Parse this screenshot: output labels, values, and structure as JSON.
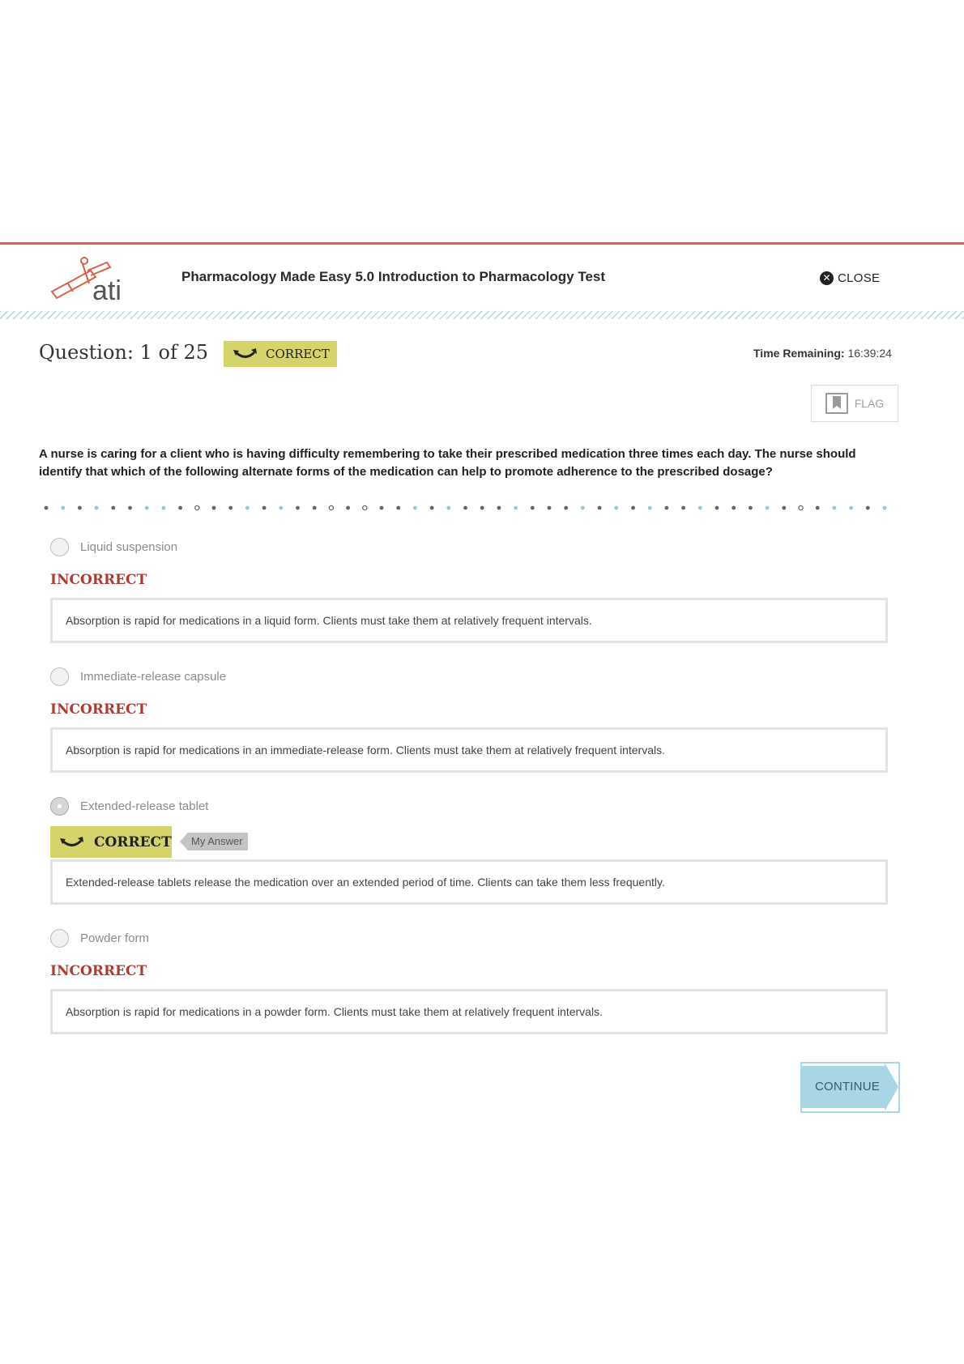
{
  "header": {
    "logo_text": "ati",
    "test_title": "Pharmacology Made Easy 5.0 Introduction to Pharmacology Test",
    "close_label": "CLOSE",
    "close_icon": "close-circle-icon"
  },
  "question": {
    "heading": "Question: 1 of 25",
    "status_badge": "CORRECT",
    "time_label": "Time Remaining:",
    "time_value": "16:39:24",
    "flag_label": "FLAG",
    "text": "A nurse is caring for a client who is having difficulty remembering to take their prescribed medication three times each day. The nurse should identify that which of the following alternate forms of the medication can help to promote adherence to the prescribed dosage?"
  },
  "options": [
    {
      "label": "Liquid suspension",
      "selected": false,
      "status": "INCORRECT",
      "rationale": "Absorption is rapid for medications in a liquid form. Clients must take them at relatively frequent intervals."
    },
    {
      "label": "Immediate-release capsule",
      "selected": false,
      "status": "INCORRECT",
      "rationale": "Absorption is rapid for medications in an immediate-release form. Clients must take them at relatively frequent intervals."
    },
    {
      "label": "Extended-release tablet",
      "selected": true,
      "status": "CORRECT",
      "my_answer_label": "My Answer",
      "rationale": "Extended-release tablets release the medication over an extended period of time. Clients can take them less frequently."
    },
    {
      "label": "Powder form",
      "selected": false,
      "status": "INCORRECT",
      "rationale": "Absorption is rapid for medications in a powder form. Clients must take them at relatively frequent intervals."
    }
  ],
  "footer": {
    "continue_label": "CONTINUE"
  },
  "colors": {
    "accent_red": "#d9614a",
    "correct_badge": "#d4d46b",
    "incorrect_text": "#b03a2e",
    "continue_button": "#a9d6e5",
    "progress_blue": "#8ec9de",
    "progress_gray": "#666666"
  }
}
